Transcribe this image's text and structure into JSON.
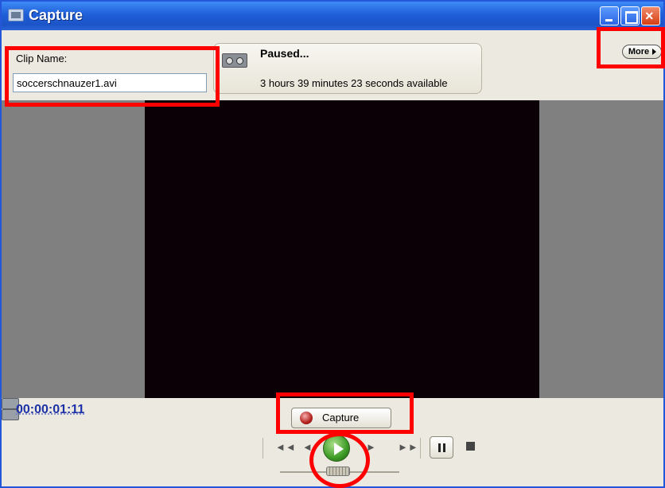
{
  "window": {
    "title": "Capture",
    "icons": {
      "app": "capture-app-icon",
      "minimize": "minimize-icon",
      "maximize": "maximize-icon",
      "close": "close-icon"
    },
    "close_glyph": "×"
  },
  "clip": {
    "label": "Clip Name:",
    "value": "soccerschnauzer1.avi"
  },
  "status": {
    "state": "Paused...",
    "available": "3 hours 39 minutes 23 seconds available",
    "icon": "tape-icon"
  },
  "more_button": {
    "label": "More"
  },
  "timecode": "00:00:01:11",
  "capture_button": {
    "label": "Capture",
    "icon": "record-icon"
  },
  "transport": {
    "rewind": "◄◄",
    "step_back": "◄",
    "step_forward": "►",
    "fast_forward": "►►",
    "icons": [
      "camera-in-icon",
      "camera-out-icon",
      "rewind-icon",
      "step-back-icon",
      "play-icon",
      "step-forward-icon",
      "fast-forward-icon",
      "pause-icon",
      "stop-icon"
    ]
  },
  "annotation_color": "#ff0000"
}
